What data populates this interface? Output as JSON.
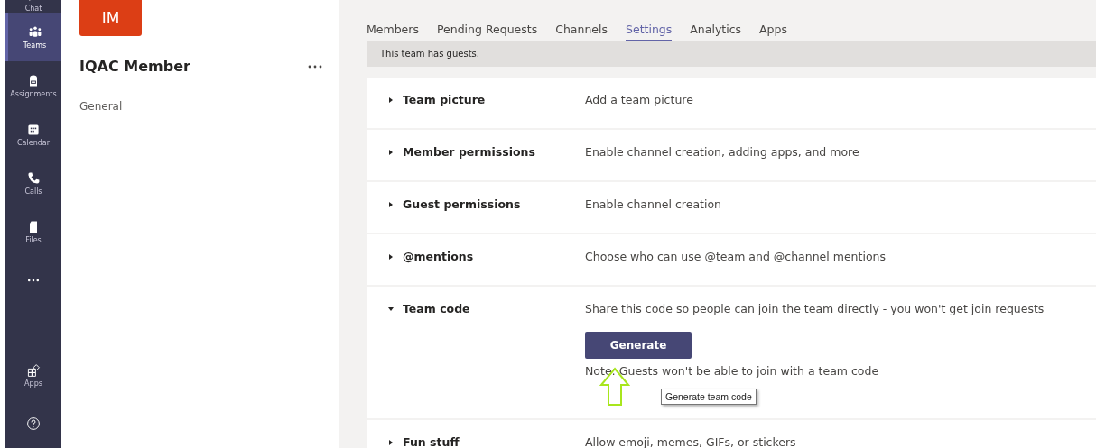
{
  "rail": {
    "items": [
      {
        "label": "Chat",
        "selected": false
      },
      {
        "label": "Teams",
        "selected": true
      },
      {
        "label": "Assignments",
        "selected": false
      },
      {
        "label": "Calendar",
        "selected": false
      },
      {
        "label": "Calls",
        "selected": false
      },
      {
        "label": "Files",
        "selected": false
      },
      {
        "selected": false
      }
    ],
    "bottom": [
      {
        "label": "Apps",
        "kind": "apps"
      },
      {
        "kind": "help"
      }
    ]
  },
  "team": {
    "initials": "IM",
    "name": "IQAC Member",
    "channels": [
      "General"
    ]
  },
  "tabs": [
    {
      "label": "Members",
      "selected": false
    },
    {
      "label": "Pending Requests",
      "selected": false
    },
    {
      "label": "Channels",
      "selected": false
    },
    {
      "label": "Settings",
      "selected": true
    },
    {
      "label": "Analytics",
      "selected": false
    },
    {
      "label": "Apps",
      "selected": false
    }
  ],
  "banner": "This team has guests.",
  "settings": [
    {
      "title": "Team picture",
      "description": "Add a team picture",
      "expanded": false
    },
    {
      "title": "Member permissions",
      "description": "Enable channel creation, adding apps, and more",
      "expanded": false
    },
    {
      "title": "Guest permissions",
      "description": "Enable channel creation",
      "expanded": false
    },
    {
      "title": "@mentions",
      "description": "Choose who can use @team and @channel mentions",
      "expanded": false
    },
    {
      "title": "Team code",
      "description": "Share this code so people can join the team directly - you won't get join requests",
      "expanded": true,
      "button": "Generate",
      "note": "Note: Guests won't be able to join with a team code",
      "tooltip": "Generate team code"
    },
    {
      "title": "Fun stuff",
      "description": "Allow emoji, memes, GIFs, or stickers",
      "expanded": false
    }
  ]
}
